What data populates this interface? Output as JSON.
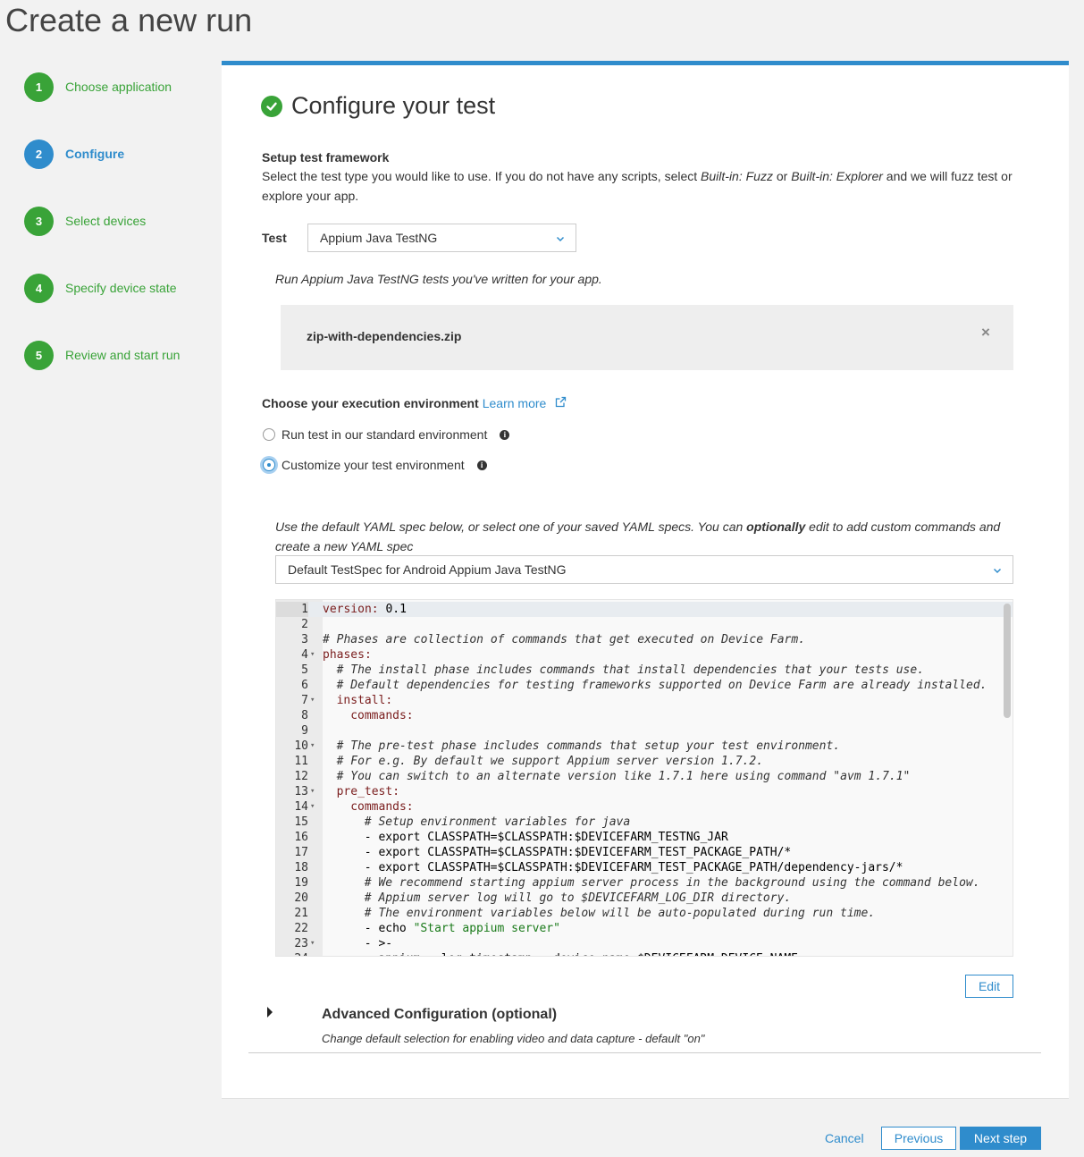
{
  "page": {
    "title": "Create a new run"
  },
  "steps": [
    {
      "num": "1",
      "label": "Choose application",
      "state": "done"
    },
    {
      "num": "2",
      "label": "Configure",
      "state": "active"
    },
    {
      "num": "3",
      "label": "Select devices",
      "state": "done"
    },
    {
      "num": "4",
      "label": "Specify device state",
      "state": "done"
    },
    {
      "num": "5",
      "label": "Review and start run",
      "state": "done"
    }
  ],
  "main": {
    "heading": "Configure your test",
    "setup_title": "Setup test framework",
    "setup_desc_1": "Select the test type you would like to use. If you do not have any scripts, select ",
    "setup_desc_fuzz": "Built-in: Fuzz",
    "setup_desc_or": " or ",
    "setup_desc_explorer": "Built-in: Explorer",
    "setup_desc_2": " and we will fuzz test or",
    "setup_desc_3": "explore your app.",
    "test_label": "Test",
    "test_select_value": "Appium Java TestNG",
    "test_hint": "Run Appium Java TestNG tests you've written for your app.",
    "file_name": "zip-with-dependencies.zip",
    "remove_symbol": "×",
    "exec_env_title": "Choose your execution environment",
    "learn_more": "Learn more",
    "radio_standard": "Run test in our standard environment",
    "radio_custom": "Customize your test environment",
    "yaml_hint_1": "Use the default YAML spec below, or select one of your saved YAML specs. You can ",
    "yaml_hint_bold": "optionally",
    "yaml_hint_2": " edit to add custom commands and",
    "yaml_hint_3": "create a new YAML spec",
    "yaml_select_value": "Default TestSpec for Android Appium Java TestNG",
    "edit_button": "Edit",
    "advanced_title": "Advanced Configuration (optional)",
    "advanced_desc": "Change default selection for enabling video and data capture - default \"on\""
  },
  "code_lines": [
    {
      "n": "1",
      "fold": "",
      "indent": 0,
      "parts": [
        [
          "key",
          "version:"
        ],
        [
          "plain",
          " 0.1"
        ]
      ]
    },
    {
      "n": "2",
      "fold": "",
      "indent": 0,
      "parts": []
    },
    {
      "n": "3",
      "fold": "",
      "indent": 0,
      "parts": [
        [
          "com",
          "# Phases are collection of commands that get executed on Device Farm."
        ]
      ]
    },
    {
      "n": "4",
      "fold": "▾",
      "indent": 0,
      "parts": [
        [
          "key",
          "phases:"
        ]
      ]
    },
    {
      "n": "5",
      "fold": "",
      "indent": 2,
      "parts": [
        [
          "com",
          "# The install phase includes commands that install dependencies that your tests use."
        ]
      ]
    },
    {
      "n": "6",
      "fold": "",
      "indent": 2,
      "parts": [
        [
          "com",
          "# Default dependencies for testing frameworks supported on Device Farm are already installed."
        ]
      ]
    },
    {
      "n": "7",
      "fold": "▾",
      "indent": 2,
      "parts": [
        [
          "key",
          "install:"
        ]
      ]
    },
    {
      "n": "8",
      "fold": "",
      "indent": 4,
      "parts": [
        [
          "key",
          "commands:"
        ]
      ]
    },
    {
      "n": "9",
      "fold": "",
      "indent": 0,
      "parts": []
    },
    {
      "n": "10",
      "fold": "▾",
      "indent": 2,
      "parts": [
        [
          "com",
          "# The pre-test phase includes commands that setup your test environment."
        ]
      ]
    },
    {
      "n": "11",
      "fold": "",
      "indent": 2,
      "parts": [
        [
          "com",
          "# For e.g. By default we support Appium server version 1.7.2."
        ]
      ]
    },
    {
      "n": "12",
      "fold": "",
      "indent": 2,
      "parts": [
        [
          "com",
          "# You can switch to an alternate version like 1.7.1 here using command \"avm 1.7.1\""
        ]
      ]
    },
    {
      "n": "13",
      "fold": "▾",
      "indent": 2,
      "parts": [
        [
          "key",
          "pre_test:"
        ]
      ]
    },
    {
      "n": "14",
      "fold": "▾",
      "indent": 4,
      "parts": [
        [
          "key",
          "commands:"
        ]
      ]
    },
    {
      "n": "15",
      "fold": "",
      "indent": 6,
      "parts": [
        [
          "com",
          "# Setup environment variables for java"
        ]
      ]
    },
    {
      "n": "16",
      "fold": "",
      "indent": 6,
      "parts": [
        [
          "plain",
          "- export CLASSPATH=$CLASSPATH:$DEVICEFARM_TESTNG_JAR"
        ]
      ]
    },
    {
      "n": "17",
      "fold": "",
      "indent": 6,
      "parts": [
        [
          "plain",
          "- export CLASSPATH=$CLASSPATH:$DEVICEFARM_TEST_PACKAGE_PATH/*"
        ]
      ]
    },
    {
      "n": "18",
      "fold": "",
      "indent": 6,
      "parts": [
        [
          "plain",
          "- export CLASSPATH=$CLASSPATH:$DEVICEFARM_TEST_PACKAGE_PATH/dependency-jars/*"
        ]
      ]
    },
    {
      "n": "19",
      "fold": "",
      "indent": 6,
      "parts": [
        [
          "com",
          "# We recommend starting appium server process in the background using the command below."
        ]
      ]
    },
    {
      "n": "20",
      "fold": "",
      "indent": 6,
      "parts": [
        [
          "com",
          "# Appium server log will go to $DEVICEFARM_LOG_DIR directory."
        ]
      ]
    },
    {
      "n": "21",
      "fold": "",
      "indent": 6,
      "parts": [
        [
          "com",
          "# The environment variables below will be auto-populated during run time."
        ]
      ]
    },
    {
      "n": "22",
      "fold": "",
      "indent": 6,
      "parts": [
        [
          "plain",
          "- echo "
        ],
        [
          "str",
          "\"Start appium server\""
        ]
      ]
    },
    {
      "n": "23",
      "fold": "▾",
      "indent": 6,
      "parts": [
        [
          "plain",
          "- >-"
        ]
      ]
    },
    {
      "n": "24",
      "fold": "",
      "indent": 8,
      "parts": [
        [
          "plain",
          "appium --log-timestamp --device-name $DEVICEFARM_DEVICE_NAME"
        ]
      ]
    }
  ],
  "footer": {
    "cancel": "Cancel",
    "previous": "Previous",
    "next": "Next step"
  },
  "colors": {
    "accent": "#2f8ccc",
    "success": "#39a338"
  },
  "icons": {
    "check": "check-circle-icon",
    "dropdown": "chevron-down-icon",
    "remove": "close-icon",
    "external": "external-link-icon",
    "info": "info-icon",
    "expand": "caret-right-icon"
  }
}
